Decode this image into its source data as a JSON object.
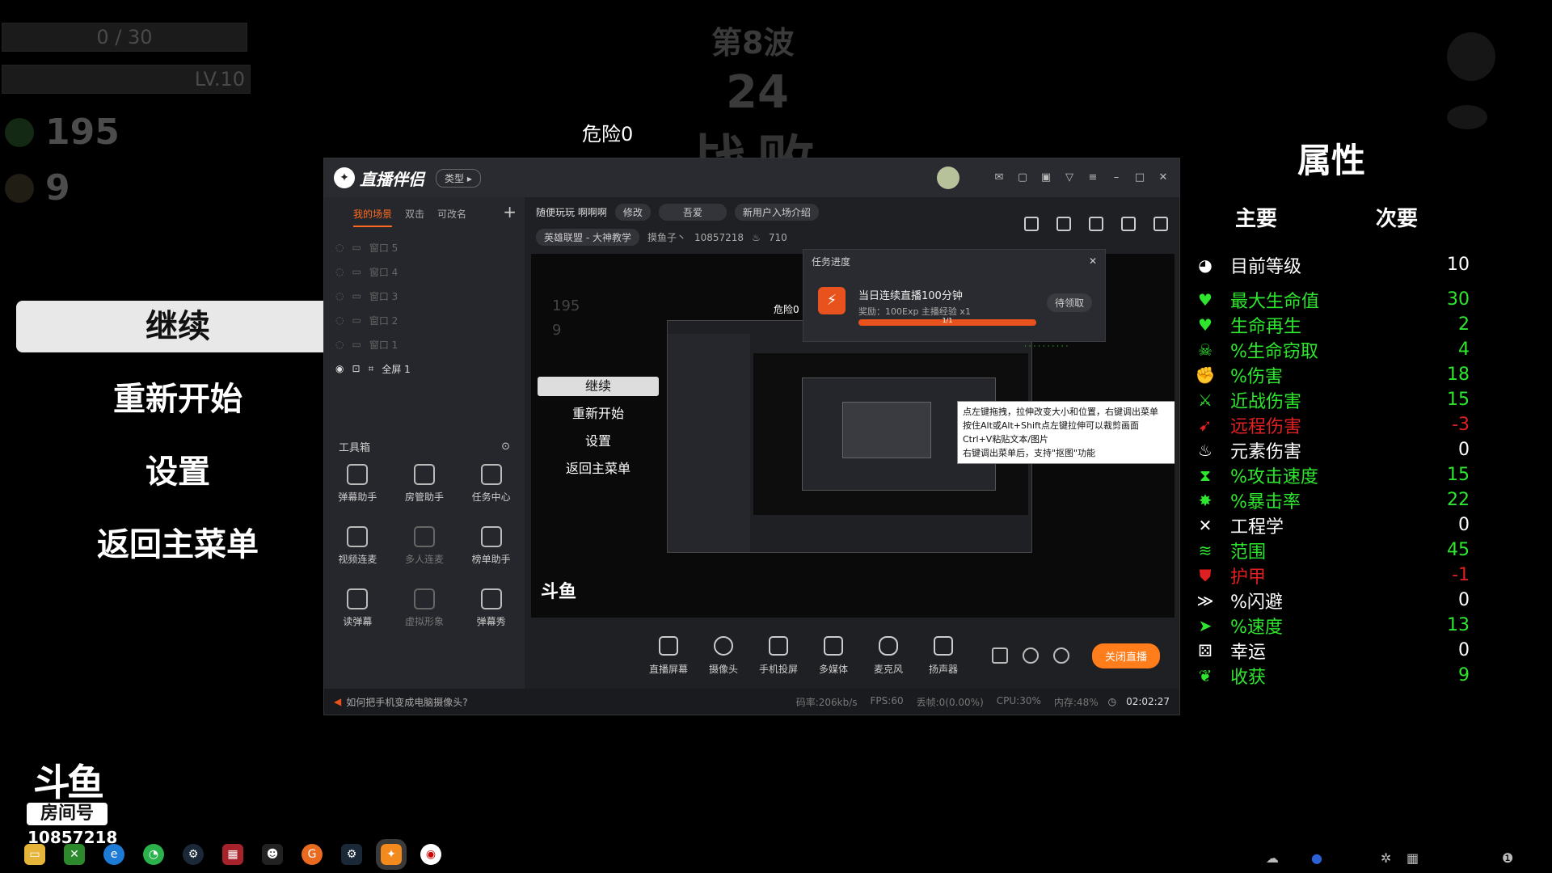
{
  "hud": {
    "xp": "0 / 30",
    "level": "LV.10",
    "materials": "195",
    "bag": "9",
    "wave": "第8波",
    "timer": "24",
    "defeat": "战败",
    "danger": "危险0"
  },
  "menu": {
    "continue": "继续",
    "restart": "重新开始",
    "settings": "设置",
    "main_menu": "返回主菜单"
  },
  "stats": {
    "title": "属性",
    "tab_main": "主要",
    "tab_sub": "次要",
    "items": [
      {
        "name": "目前等级",
        "value": "10",
        "color": "white",
        "icon": "level-icon",
        "glyph": "◕"
      },
      {
        "name": "最大生命值",
        "value": "30",
        "color": "green",
        "icon": "heart-icon",
        "glyph": "♥"
      },
      {
        "name": "生命再生",
        "value": "2",
        "color": "green",
        "icon": "regen-heart-icon",
        "glyph": "♥"
      },
      {
        "name": "%生命窃取",
        "value": "4",
        "color": "green",
        "icon": "lifesteal-icon",
        "glyph": "☠"
      },
      {
        "name": "%伤害",
        "value": "18",
        "color": "green",
        "icon": "muscle-icon",
        "glyph": "✊"
      },
      {
        "name": "近战伤害",
        "value": "15",
        "color": "green",
        "icon": "sword-icon",
        "glyph": "⚔"
      },
      {
        "name": "远程伤害",
        "value": "-3",
        "color": "red",
        "icon": "bow-icon",
        "glyph": "➹"
      },
      {
        "name": "元素伤害",
        "value": "0",
        "color": "white",
        "icon": "flame-icon",
        "glyph": "♨"
      },
      {
        "name": "%攻击速度",
        "value": "15",
        "color": "green",
        "icon": "hourglass-icon",
        "glyph": "⧗"
      },
      {
        "name": "%暴击率",
        "value": "22",
        "color": "green",
        "icon": "crit-icon",
        "glyph": "✸"
      },
      {
        "name": "工程学",
        "value": "0",
        "color": "white",
        "icon": "wrench-icon",
        "glyph": "✕"
      },
      {
        "name": "范围",
        "value": "45",
        "color": "green",
        "icon": "range-icon",
        "glyph": "≋"
      },
      {
        "name": "护甲",
        "value": "-1",
        "color": "red",
        "icon": "shield-icon",
        "glyph": "⛊"
      },
      {
        "name": "%闪避",
        "value": "0",
        "color": "white",
        "icon": "dodge-icon",
        "glyph": "≫"
      },
      {
        "name": "%速度",
        "value": "13",
        "color": "green",
        "icon": "boot-icon",
        "glyph": "➤"
      },
      {
        "name": "幸运",
        "value": "0",
        "color": "white",
        "icon": "dice-icon",
        "glyph": "⚄"
      },
      {
        "name": "收获",
        "value": "9",
        "color": "green",
        "icon": "harvest-icon",
        "glyph": "❦"
      }
    ]
  },
  "overlay": {
    "douyu_logo": "斗鱼",
    "douyu_badge": "房间号",
    "room_number": "10857218"
  },
  "app": {
    "name": "直播伴侣",
    "type_button": "类型",
    "scene_tabs": [
      "我的场景",
      "双击",
      "可改名"
    ],
    "sources": [
      "窗口 5",
      "窗口 4",
      "窗口 3",
      "窗口 2",
      "窗口 1",
      "全屏 1"
    ],
    "toolbox_label": "工具箱",
    "tools": [
      "弹幕助手",
      "房管助手",
      "任务中心",
      "视频连麦",
      "多人连麦",
      "榜单助手",
      "读弹幕",
      "虚拟形象",
      "弹幕秀"
    ],
    "live_title": "随便玩玩 啊啊啊",
    "edit_label": "修改",
    "song_pill": "吾爱",
    "intro_pill": "新用户入场介绍",
    "category": "英雄联盟 - 大神教学",
    "streamer": "摸鱼子丶",
    "room_id": "10857218",
    "heat": "710",
    "task": {
      "header": "任务进度",
      "title": "当日连续直播100分钟",
      "reward": "奖励：100Exp 主播经验 x1",
      "claim": "待领取",
      "progress_text": "1/1",
      "progress": 1.0
    },
    "tooltip": [
      "点左键拖拽，拉伸改变大小和位置，右键调出菜单",
      "按住Alt或Alt+Shift点左键拉伸可以裁剪画面",
      "Ctrl+V粘贴文本/图片",
      "右键调出菜单后，支持\"抠图\"功能"
    ],
    "bottom_buttons": [
      "直播屏幕",
      "摄像头",
      "手机投屏",
      "多媒体",
      "麦克风",
      "扬声器"
    ],
    "end_live": "关闭直播",
    "status_tip": "如何把手机变成电脑摄像头?",
    "status": {
      "bitrate": "码率:206kb/s",
      "fps": "FPS:60",
      "drop": "丢帧:0(0.00%)",
      "cpu": "CPU:30%",
      "mem": "内存:48%",
      "time": "02:02:27"
    },
    "preview": {
      "danger": "危险0",
      "materials": "195",
      "bag": "9",
      "continue": "继续",
      "restart": "重新开始",
      "settings": "设置",
      "main_menu": "返回主菜单",
      "logo": "斗鱼"
    }
  }
}
